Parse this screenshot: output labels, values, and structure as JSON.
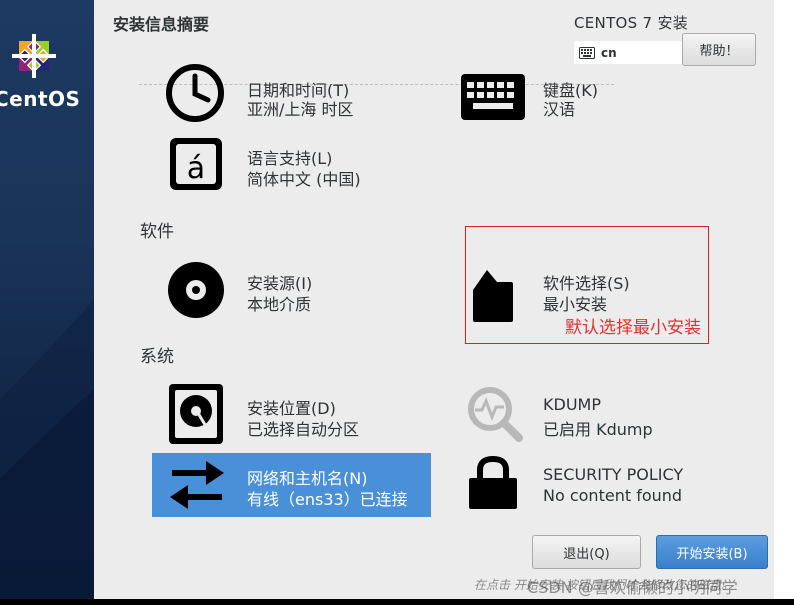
{
  "sidebar": {
    "brand": "CentOS"
  },
  "header": {
    "title": "安装信息摘要",
    "install_title": "CENTOS 7 安装",
    "keyboard_layout": "cn",
    "help_label": "帮助！"
  },
  "sections": {
    "localization": {
      "datetime": {
        "label": "日期和时间(T)",
        "status": "亚洲/上海 时区"
      },
      "keyboard": {
        "label": "键盘(K)",
        "status": "汉语"
      },
      "language": {
        "label": "语言支持(L)",
        "status": "简体中文 (中国)"
      }
    },
    "software": {
      "title": "软件",
      "source": {
        "label": "安装源(I)",
        "status": "本地介质"
      },
      "selection": {
        "label": "软件选择(S)",
        "status": "最小安装"
      }
    },
    "system": {
      "title": "系统",
      "destination": {
        "label": "安装位置(D)",
        "status": "已选择自动分区"
      },
      "kdump": {
        "label": "KDUMP",
        "status": "已启用 Kdump"
      },
      "network": {
        "label": "网络和主机名(N)",
        "status": "有线（ens33）已连接"
      },
      "security": {
        "label": "SECURITY POLICY",
        "status": "No content found"
      }
    }
  },
  "annotation": {
    "text": "默认选择最小安装",
    "color": "#e02020"
  },
  "buttons": {
    "quit": "退出(Q)",
    "begin": "开始安装(B)"
  },
  "footer": {
    "note": "在点击 开始安装 按钮后我们才会修改您的磁盘。"
  },
  "watermark": "CSDN @喜欢偷懒的小明同学",
  "colors": {
    "accent": "#4a90d9",
    "sidebar": "#1a3358",
    "annotation": "#e02020"
  }
}
